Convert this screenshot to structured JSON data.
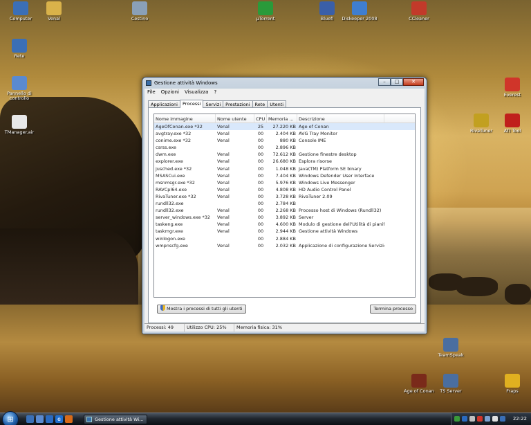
{
  "desktop": {
    "icons": [
      {
        "label": "Computer",
        "icon": "computer-icon",
        "color": "#3b6fb6"
      },
      {
        "label": "Venal",
        "icon": "user-folder-icon",
        "color": "#d9b24a"
      },
      {
        "label": "Cestino",
        "icon": "recycle-bin-icon",
        "color": "#8aa0b8"
      },
      {
        "label": "µTorrent",
        "icon": "utorrent-icon",
        "color": "#2a9a3a"
      },
      {
        "label": "Bluefi",
        "icon": "shortcut-icon",
        "color": "#3a5fa8"
      },
      {
        "label": "Diskeeper 2008",
        "icon": "diskeeper-icon",
        "color": "#3f7ed0"
      },
      {
        "label": "CCleaner",
        "icon": "ccleaner-icon",
        "color": "#c23a2a"
      },
      {
        "label": "Rete",
        "icon": "network-icon",
        "color": "#3b6fb6"
      },
      {
        "label": "Pannello di controllo",
        "icon": "control-panel-icon",
        "color": "#5a8ad0"
      },
      {
        "label": "TManager.air",
        "icon": "air-file-icon",
        "color": "#e8e8e8"
      },
      {
        "label": "Everest",
        "icon": "everest-icon",
        "color": "#d0352a"
      },
      {
        "label": "RivaTuner",
        "icon": "rivatuner-icon",
        "color": "#c2a020"
      },
      {
        "label": "ATI Tool",
        "icon": "ati-tool-icon",
        "color": "#c0201c"
      },
      {
        "label": "TeamSpeak",
        "icon": "teamspeak-icon",
        "color": "#4a6ea0"
      },
      {
        "label": "Age of Conan",
        "icon": "age-of-conan-icon",
        "color": "#7a2a1a"
      },
      {
        "label": "TS Server",
        "icon": "ts-server-icon",
        "color": "#4a6ea0"
      },
      {
        "label": "Fraps",
        "icon": "fraps-icon",
        "color": "#e0b020"
      }
    ]
  },
  "window": {
    "title": "Gestione attività Windows",
    "menu": [
      "File",
      "Opzioni",
      "Visualizza",
      "?"
    ],
    "tabs": [
      "Applicazioni",
      "Processi",
      "Servizi",
      "Prestazioni",
      "Rete",
      "Utenti"
    ],
    "active_tab": "Processi",
    "columns": [
      "Nome immagine",
      "Nome utente",
      "CPU",
      "Memoria ...",
      "Descrizione"
    ],
    "processes": [
      {
        "name": "AgeOfConan.exe *32",
        "user": "Venal",
        "cpu": "25",
        "mem": "27.220 KB",
        "desc": "Age of Conan"
      },
      {
        "name": "avgtray.exe *32",
        "user": "Venal",
        "cpu": "00",
        "mem": "2.404 KB",
        "desc": "AVG Tray Monitor"
      },
      {
        "name": "conime.exe *32",
        "user": "Venal",
        "cpu": "00",
        "mem": "880 KB",
        "desc": "Console IME"
      },
      {
        "name": "csrss.exe",
        "user": "",
        "cpu": "00",
        "mem": "2.896 KB",
        "desc": ""
      },
      {
        "name": "dwm.exe",
        "user": "Venal",
        "cpu": "00",
        "mem": "72.612 KB",
        "desc": "Gestione finestre desktop"
      },
      {
        "name": "explorer.exe",
        "user": "Venal",
        "cpu": "00",
        "mem": "26.680 KB",
        "desc": "Esplora risorse"
      },
      {
        "name": "jusched.exe *32",
        "user": "Venal",
        "cpu": "00",
        "mem": "1.048 KB",
        "desc": "Java(TM) Platform SE binary"
      },
      {
        "name": "MSASCui.exe",
        "user": "Venal",
        "cpu": "00",
        "mem": "7.404 KB",
        "desc": "Windows Defender User Interface"
      },
      {
        "name": "msnmsgr.exe *32",
        "user": "Venal",
        "cpu": "00",
        "mem": "5.976 KB",
        "desc": "Windows Live Messenger"
      },
      {
        "name": "RAVCpl64.exe",
        "user": "Venal",
        "cpu": "00",
        "mem": "4.808 KB",
        "desc": "HD Audio Control Panel"
      },
      {
        "name": "RivaTuner.exe *32",
        "user": "Venal",
        "cpu": "00",
        "mem": "3.728 KB",
        "desc": "RivaTuner 2.09"
      },
      {
        "name": "rundll32.exe",
        "user": "",
        "cpu": "00",
        "mem": "2.784 KB",
        "desc": ""
      },
      {
        "name": "rundll32.exe",
        "user": "Venal",
        "cpu": "00",
        "mem": "2.268 KB",
        "desc": "Processo host di Windows (Rundll32)"
      },
      {
        "name": "server_windows.exe *32",
        "user": "Venal",
        "cpu": "00",
        "mem": "3.892 KB",
        "desc": "Server"
      },
      {
        "name": "taskeng.exe",
        "user": "Venal",
        "cpu": "00",
        "mem": "4.600 KB",
        "desc": "Modulo di gestione dell'Utilità di pianific..."
      },
      {
        "name": "taskmgr.exe",
        "user": "Venal",
        "cpu": "00",
        "mem": "2.944 KB",
        "desc": "Gestione attività Windows"
      },
      {
        "name": "winlogon.exe",
        "user": "",
        "cpu": "00",
        "mem": "2.884 KB",
        "desc": ""
      },
      {
        "name": "wmpnscfg.exe",
        "user": "Venal",
        "cpu": "00",
        "mem": "2.032 KB",
        "desc": "Applicazione di configurazione Servizio ..."
      }
    ],
    "show_all_button": "Mostra i processi di tutti gli utenti",
    "end_process_button": "Termina processo",
    "status": {
      "processes": "Processi: 49",
      "cpu": "Utilizzo CPU: 25%",
      "memory": "Memoria fisica: 31%"
    }
  },
  "taskbar": {
    "task_label": "Gestione attività Wi...",
    "clock": "22:22"
  }
}
